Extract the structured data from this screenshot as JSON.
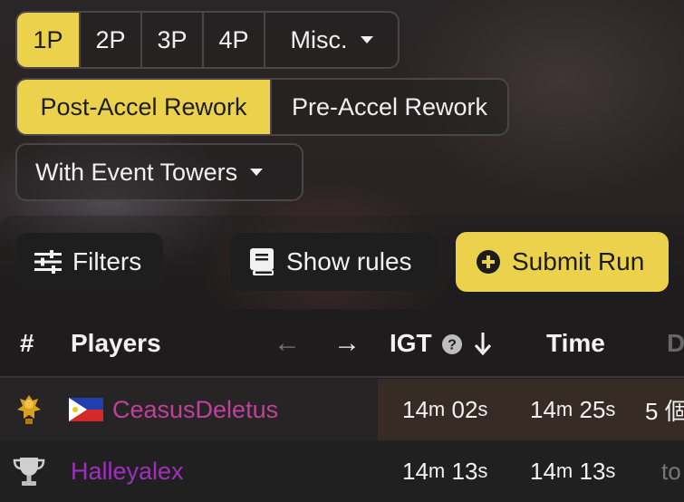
{
  "player_tabs": [
    {
      "label": "1P",
      "active": true
    },
    {
      "label": "2P",
      "active": false
    },
    {
      "label": "3P",
      "active": false
    },
    {
      "label": "4P",
      "active": false
    },
    {
      "label": "Misc.",
      "active": false,
      "dropdown": true
    }
  ],
  "version_tabs": [
    {
      "label": "Post-Accel Rework",
      "active": true
    },
    {
      "label": "Pre-Accel Rework",
      "active": false
    }
  ],
  "variable_select": {
    "value": "With Event Towers"
  },
  "toolbar": {
    "filters_label": "Filters",
    "rules_label": "Show rules",
    "submit_label": "Submit Run"
  },
  "table": {
    "headers": {
      "rank": "#",
      "players": "Players",
      "prev": "←",
      "next": "→",
      "igt": "IGT",
      "time": "Time",
      "date": "D"
    },
    "rows": [
      {
        "player": "CeasusDeletus",
        "igt_m": "14",
        "igt_s": "02",
        "time_m": "14",
        "time_s": "25",
        "date": "5 個",
        "player_color": "#c0409a"
      },
      {
        "player": "Halleyalex",
        "igt_m": "14",
        "igt_s": "13",
        "time_m": "14",
        "time_s": "13",
        "date": "to",
        "player_color": "#a02fc0"
      }
    ]
  },
  "colors": {
    "accent": "#ecd14d",
    "rank1_gold": "#d8a023",
    "rank2_silver": "#cfcfcf"
  }
}
